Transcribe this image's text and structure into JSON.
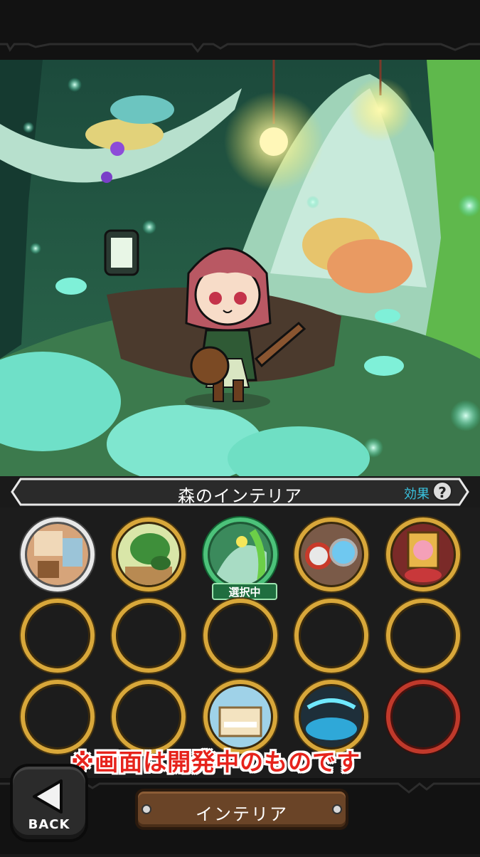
{
  "section": {
    "title": "森のインテリア",
    "effect_label": "効果",
    "help_symbol": "?"
  },
  "slots": [
    {
      "state": "owned",
      "theme": "wooden-room",
      "selected": false
    },
    {
      "state": "owned",
      "theme": "plant-room",
      "selected": false
    },
    {
      "state": "owned",
      "theme": "forest-room",
      "selected": true,
      "badge": "選択中"
    },
    {
      "state": "owned",
      "theme": "ship-room",
      "selected": false
    },
    {
      "state": "owned",
      "theme": "pig-portrait-room",
      "selected": false
    },
    {
      "state": "empty"
    },
    {
      "state": "empty"
    },
    {
      "state": "empty"
    },
    {
      "state": "empty"
    },
    {
      "state": "empty"
    },
    {
      "state": "empty"
    },
    {
      "state": "empty"
    },
    {
      "state": "owned",
      "theme": "piano-room",
      "selected": false
    },
    {
      "state": "owned",
      "theme": "blue-magic-room",
      "selected": false
    },
    {
      "state": "empty-red"
    }
  ],
  "notice": "※画面は開発中のものです",
  "back_button": {
    "label": "BACK"
  },
  "bottom_tab": {
    "label": "インテリア"
  },
  "colors": {
    "gold_ring": "#d8a73a",
    "selected_ring": "#4cc27a",
    "red_ring": "#c0392b",
    "effect": "#39c3e0",
    "notice": "#e6231c"
  }
}
